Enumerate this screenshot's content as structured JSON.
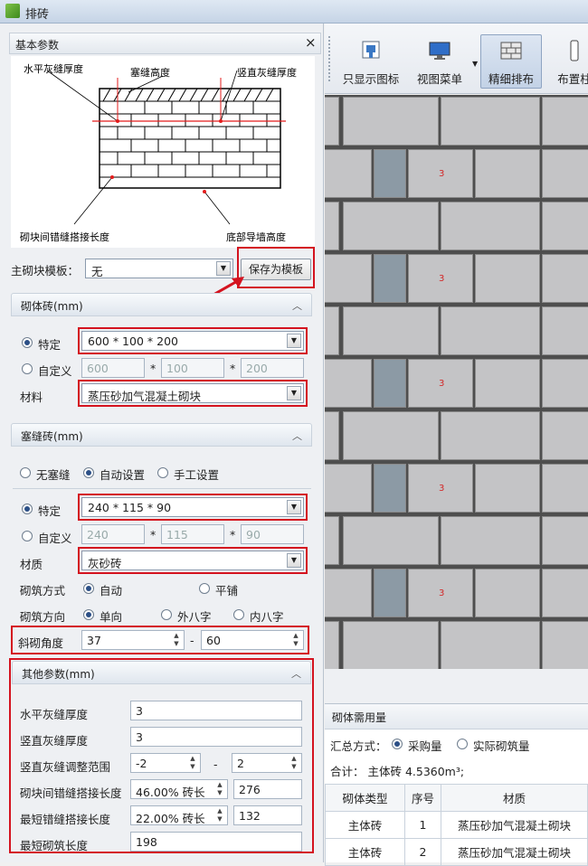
{
  "window": {
    "title": "排砖"
  },
  "panel": {
    "title": "基本参数"
  },
  "diagram": {
    "labels": {
      "horizontal_joint": "水平灰缝厚度",
      "plug_height": "塞缝高度",
      "vertical_joint": "竖直灰缝厚度",
      "stagger": "砌块间错缝搭接长度",
      "base_wall": "底部导墙高度"
    }
  },
  "template": {
    "label": "主砌块模板：",
    "value": "无",
    "save_button": "保存为模板"
  },
  "block": {
    "section_title": "砌体砖(mm)",
    "specific_label": "特定",
    "specific_value": "600 * 100 * 200",
    "custom_label": "自定义",
    "custom_l": "600",
    "custom_w": "100",
    "custom_h": "200",
    "times": "*",
    "material_label": "材料",
    "material_value": "蒸压砂加气混凝土砌块"
  },
  "plug": {
    "section_title": "塞缝砖(mm)",
    "mode_none": "无塞缝",
    "mode_auto": "自动设置",
    "mode_manual": "手工设置",
    "specific_label": "特定",
    "specific_value": "240 * 115 * 90",
    "custom_label": "自定义",
    "custom_l": "240",
    "custom_w": "115",
    "custom_h": "90",
    "material_label": "材质",
    "material_value": "灰砂砖",
    "method_label": "砌筑方式",
    "method_auto": "自动",
    "method_flat": "平铺",
    "dir_label": "砌筑方向",
    "dir_single": "单向",
    "dir_out": "外八字",
    "dir_in": "内八字",
    "angle_label": "斜砌角度",
    "angle_min": "37",
    "angle_sep": "-",
    "angle_max": "60"
  },
  "other": {
    "section_title": "其他参数(mm)",
    "h_joint_label": "水平灰缝厚度",
    "h_joint_value": "3",
    "v_joint_label": "竖直灰缝厚度",
    "v_joint_value": "3",
    "v_range_label": "竖直灰缝调整范围",
    "v_range_min": "-2",
    "v_range_sep": "-",
    "v_range_max": "2",
    "overlap_label": "砌块间错缝搭接长度",
    "overlap_pct": "46.00% 砖长",
    "overlap_value": "276",
    "min_overlap_label": "最短错缝搭接长度",
    "min_overlap_pct": "22.00% 砖长",
    "min_overlap_value": "132",
    "min_len_label": "最短砌筑长度",
    "min_len_value": "198"
  },
  "toolbar": {
    "items": [
      "只显示图标",
      "视图菜单",
      "精细排布",
      "布置柱"
    ]
  },
  "canvas": {
    "brick_number": "3"
  },
  "usage": {
    "title": "砌体需用量",
    "summary_label": "汇总方式：",
    "opt_purchase": "采购量",
    "opt_actual": "实际砌筑量",
    "total": "合计： 主体砖 4.5360m³;",
    "headers": [
      "砌体类型",
      "序号",
      "材质"
    ],
    "rows": [
      [
        "主体砖",
        "1",
        "蒸压砂加气混凝土砌块"
      ],
      [
        "主体砖",
        "2",
        "蒸压砂加气混凝土砌块"
      ]
    ]
  }
}
